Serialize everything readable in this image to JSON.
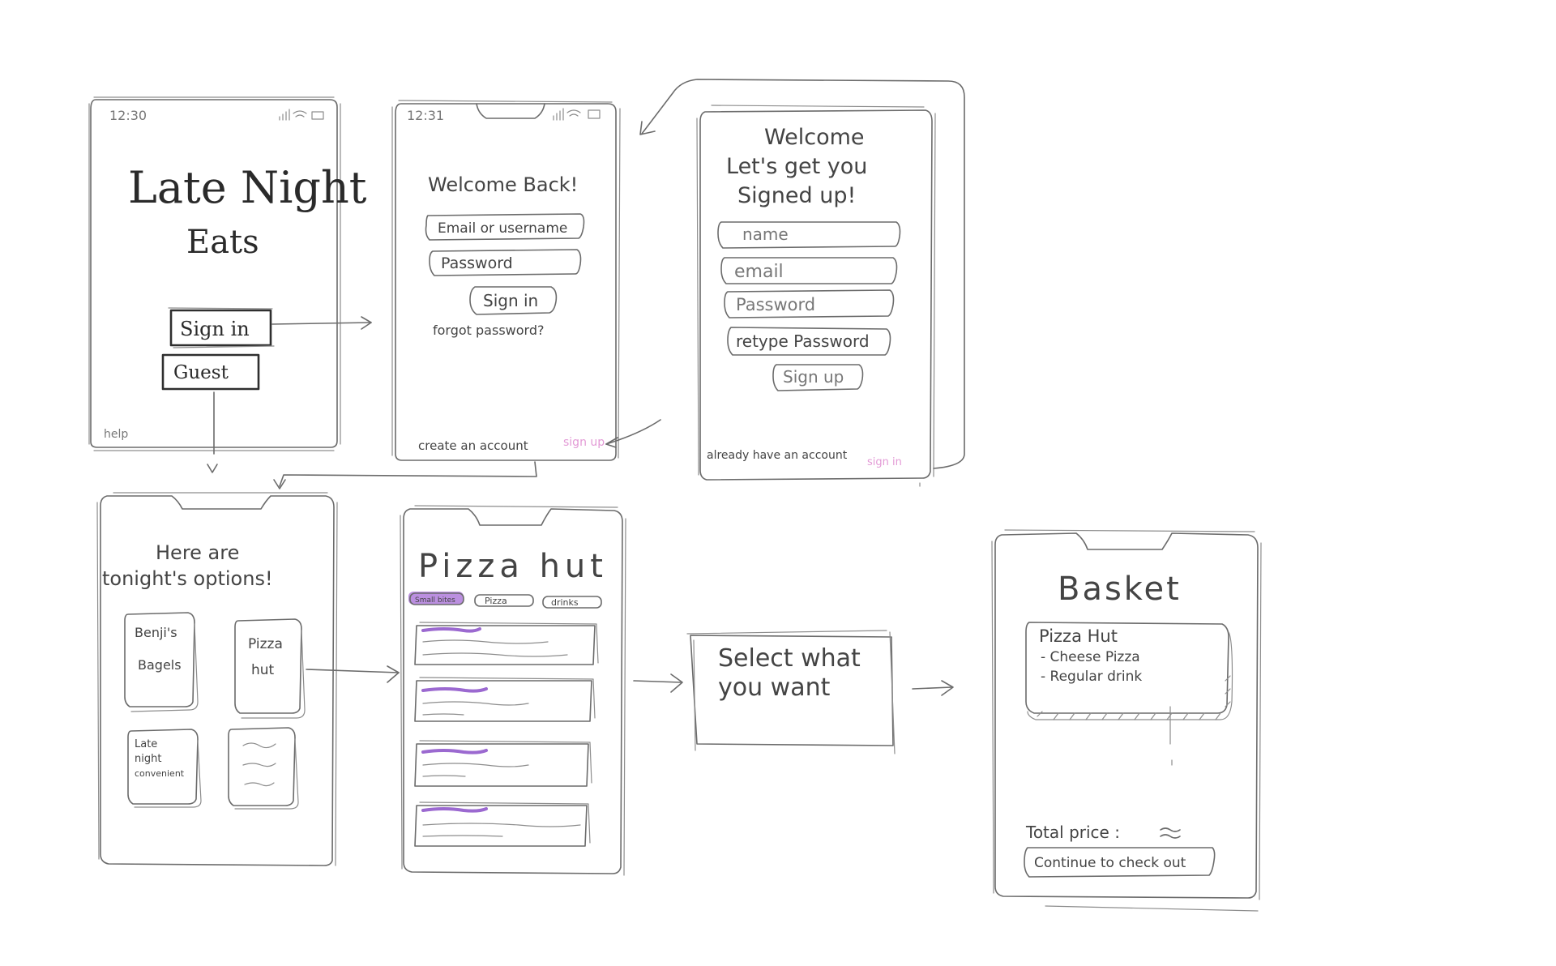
{
  "colors": {
    "sketch": "#6b6b6b",
    "accent_purple": "#a46ad6",
    "link_pink": "#e39ad6"
  },
  "screen1": {
    "time": "12:30",
    "title_line1": "Late Night",
    "title_line2": "Eats",
    "sign_in": "Sign in",
    "guest": "Guest",
    "help": "help"
  },
  "screen2": {
    "time": "12:31",
    "title": "Welcome Back!",
    "email_placeholder": "Email or username",
    "password_placeholder": "Password",
    "sign_in": "Sign in",
    "forgot": "forgot password?",
    "create_text": "create an account",
    "sign_up_link": "sign up"
  },
  "screen3": {
    "title_line1": "Welcome",
    "title_line2": "Let's get you",
    "title_line3": "Signed up!",
    "name_field": "name",
    "email_field": "email",
    "password_field": "Password",
    "retype_field": "retype Password",
    "sign_up": "Sign up",
    "already_text": "already have an account",
    "sign_in_link": "sign in"
  },
  "screen4": {
    "title_line1": "Here are",
    "title_line2": "tonight's options!",
    "options": [
      {
        "line1": "Benji's",
        "line2": "Bagels",
        "line3": ""
      },
      {
        "line1": "Pizza",
        "line2": "hut",
        "line3": ""
      },
      {
        "line1": "Late",
        "line2": "night",
        "line3": "convenient"
      }
    ]
  },
  "screen5": {
    "title": "Pizza hut",
    "tabs": [
      "Small bites",
      "Pizza",
      "drinks"
    ]
  },
  "popup": {
    "line1": "Select what",
    "line2": "you want"
  },
  "screen6": {
    "title": "Basket",
    "restaurant": "Pizza Hut",
    "item1": "- Cheese Pizza",
    "item2": "- Regular drink",
    "total_label": "Total price :",
    "checkout": "Continue to check out"
  }
}
